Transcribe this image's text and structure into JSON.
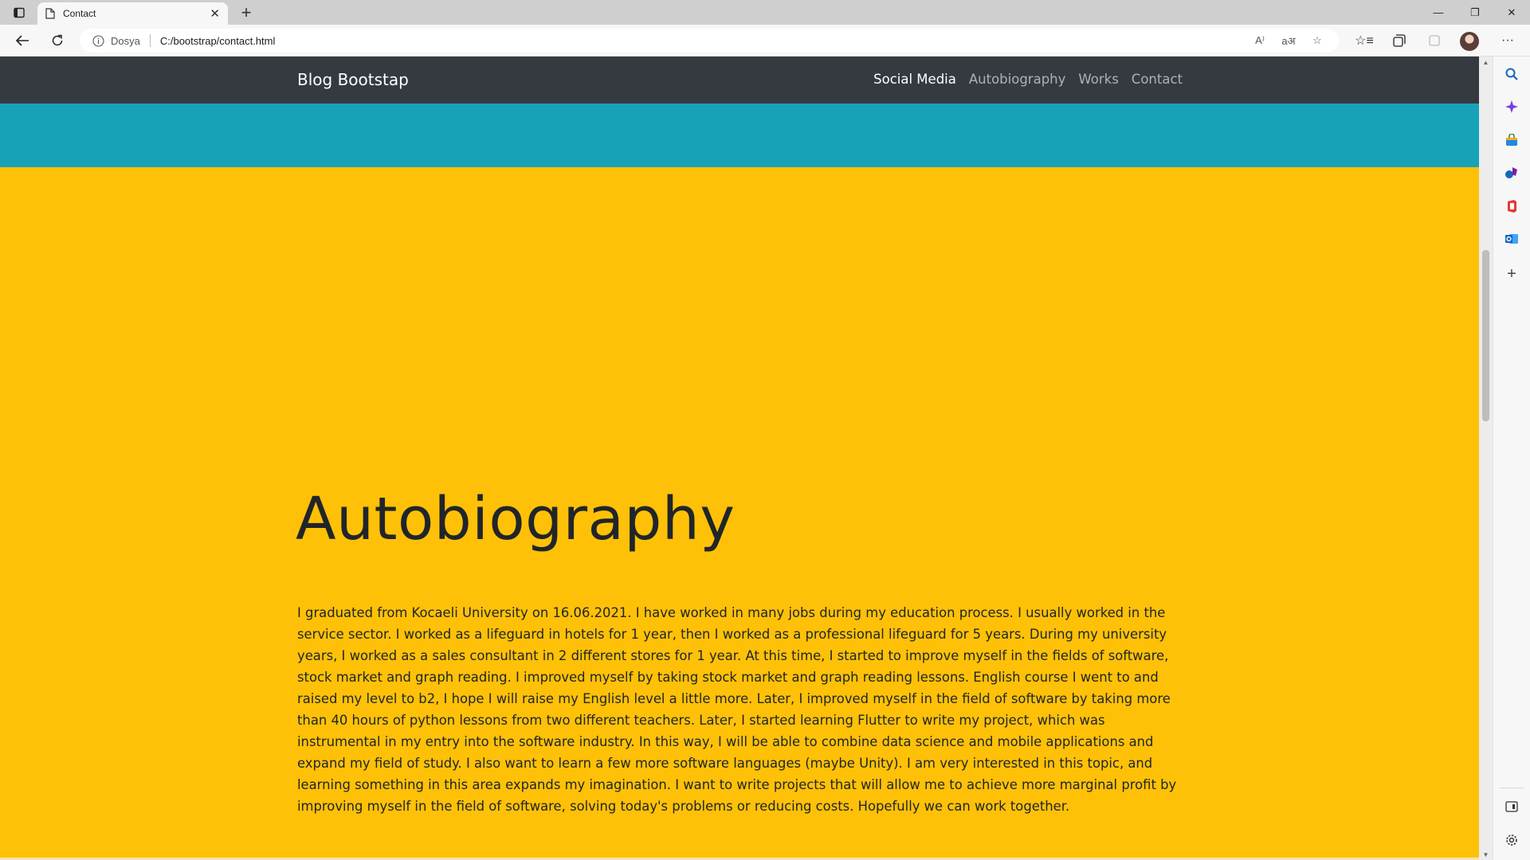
{
  "browser": {
    "tab_title": "Contact",
    "site_info_label": "Dosya",
    "url": "C:/bootstrap/contact.html",
    "read_aloud_label": "A⁾",
    "translate_label": "aअ"
  },
  "navbar": {
    "brand": "Blog Bootstap",
    "links": [
      {
        "label": "Social Media",
        "active": true
      },
      {
        "label": "Autobiography",
        "active": false
      },
      {
        "label": "Works",
        "active": false
      },
      {
        "label": "Contact",
        "active": false
      }
    ]
  },
  "content": {
    "heading": "Autobiography",
    "paragraph": "I graduated from Kocaeli University on 16.06.2021. I have worked in many jobs during my education process. I usually worked in the service sector. I worked as a lifeguard in hotels for 1 year, then I worked as a professional lifeguard for 5 years. During my university years, I worked as a sales consultant in 2 different stores for 1 year. At this time, I started to improve myself in the fields of software, stock market and graph reading. I improved myself by taking stock market and graph reading lessons. English course I went to and raised my level to b2, I hope I will raise my English level a little more. Later, I improved myself in the field of software by taking more than 40 hours of python lessons from two different teachers. Later, I started learning Flutter to write my project, which was instrumental in my entry into the software industry. In this way, I will be able to combine data science and mobile applications and expand my field of study. I also want to learn a few more software languages (maybe Unity). I am very interested in this topic, and learning something in this area expands my imagination. I want to write projects that will allow me to achieve more marginal profit by improving myself in the field of software, solving today's problems or reducing costs. Hopefully we can work together."
  },
  "colors": {
    "navbar_bg": "#343a40",
    "info_band": "#17a2b8",
    "warning_bg": "#ffc107",
    "text_dark": "#212529"
  },
  "icons": {
    "sidebar": [
      "search-icon",
      "copilot-icon",
      "shopping-icon",
      "games-icon",
      "office-icon",
      "outlook-icon",
      "add-icon",
      "sidebar-toggle-icon",
      "settings-icon"
    ]
  }
}
